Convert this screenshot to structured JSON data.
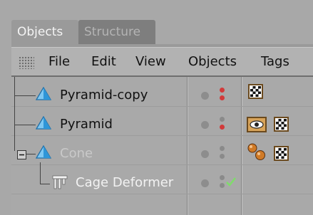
{
  "tabs": [
    {
      "label": "Objects",
      "active": true
    },
    {
      "label": "Structure",
      "active": false
    }
  ],
  "menu": [
    "File",
    "Edit",
    "View",
    "Objects",
    "Tags"
  ],
  "objects": [
    {
      "name": "Pyramid-copy",
      "icon": "pyramid-icon",
      "state": "normal",
      "tags": [
        "texture-tag-icon"
      ],
      "visibility_dots": "red"
    },
    {
      "name": "Pyramid",
      "icon": "pyramid-icon",
      "state": "normal",
      "tags": [
        "display-tag-icon",
        "texture-tag-icon"
      ],
      "visibility_dots": "grey-red"
    },
    {
      "name": "Cone",
      "icon": "cone-icon",
      "state": "disabled",
      "expanded": true,
      "tags": [
        "spheres-tag-icon",
        "texture-tag-icon"
      ],
      "visibility_dots": "grey"
    },
    {
      "name": "Cage Deformer",
      "icon": "cage-deformer-icon",
      "state": "child",
      "tags": [],
      "visibility_dots": "grey",
      "enabled_check": true
    }
  ],
  "colors": {
    "background": "#a8a8a8",
    "active_tab": "#9a9a9a",
    "inactive_tab": "#7e7e7e",
    "menubar": "#b2b2b2",
    "red_dot": "#d23a3a",
    "check_green": "#7fdc6a",
    "pyramid_blue": "#2f96d8"
  }
}
